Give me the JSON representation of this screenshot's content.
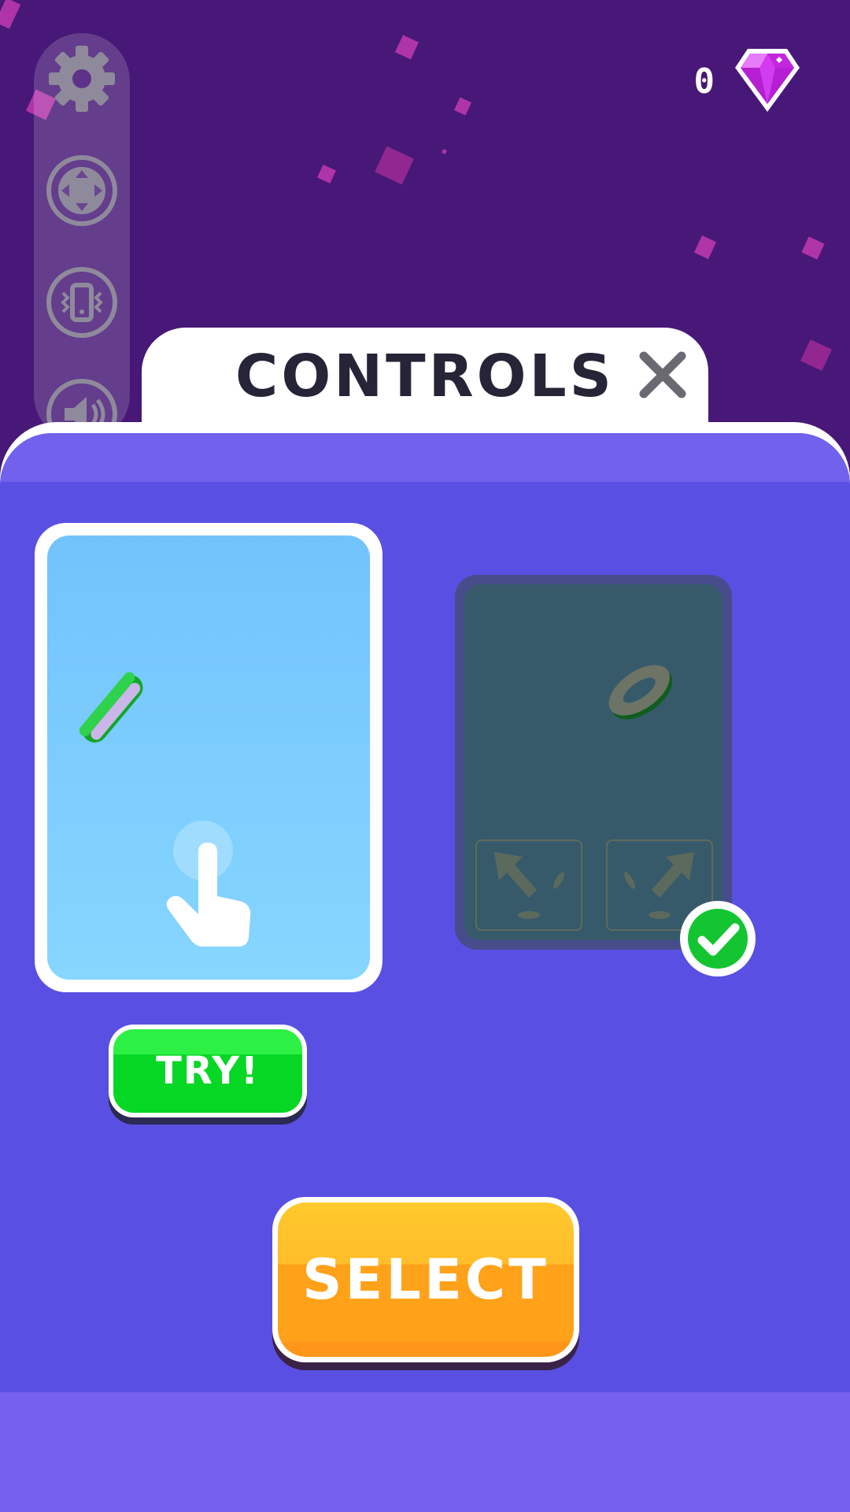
{
  "hud": {
    "gem_count": "0"
  },
  "side_rail": {
    "icons": [
      "gear-icon",
      "joystick-icon",
      "vibration-icon",
      "speaker-icon"
    ]
  },
  "modal": {
    "title": "CONTROLS",
    "close_icon": "close-icon",
    "options": [
      {
        "id": "tap-control",
        "icons": [
          "ring-icon",
          "tap-hand-icon"
        ],
        "selected": false
      },
      {
        "id": "swipe-control",
        "icons": [
          "ring-icon",
          "arrow-left-icon",
          "arrow-right-icon"
        ],
        "selected": true
      }
    ],
    "try_label": "TRY!",
    "select_label": "SELECT"
  },
  "colors": {
    "background": "#471877",
    "panel": "#5a4fe3",
    "try_green": "#06d624",
    "select_orange": "#ffa21a",
    "check_green": "#14c532",
    "gem_pink": "#d639f0"
  }
}
